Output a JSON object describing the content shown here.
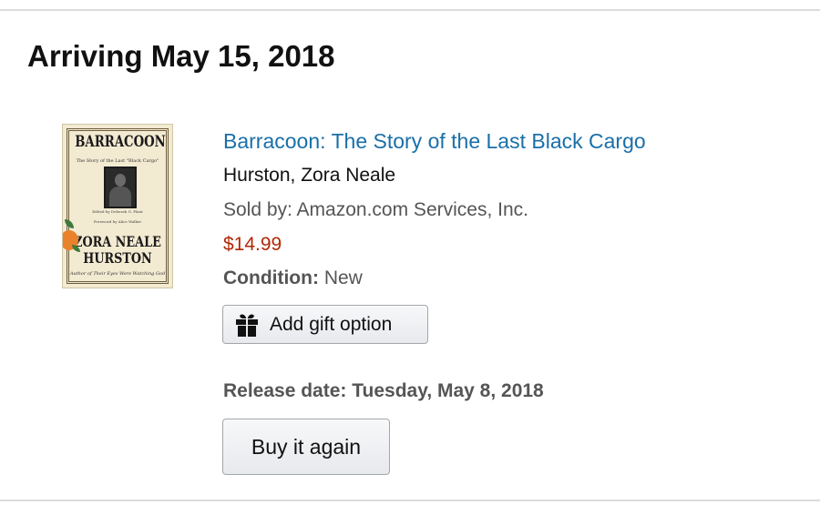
{
  "shipment": {
    "heading": "Arriving May 15, 2018"
  },
  "item": {
    "cover": {
      "title_text": "BARRACOON",
      "subtitle_text": "The Story of the Last \"Black Cargo\"",
      "editor_text": "Edited by Deborah G. Plant",
      "foreword_text": "Foreword by Alice Walker",
      "author_line1": "ZORA NEALE",
      "author_line2": "HURSTON",
      "footer_text": "Author of Their Eyes Were Watching God"
    },
    "title": "Barracoon: The Story of the Last Black Cargo",
    "author": "Hurston, Zora Neale",
    "sold_by": "Sold by: Amazon.com Services, Inc.",
    "price": "$14.99",
    "condition_label": "Condition:",
    "condition_value": "New",
    "release_date": "Release date: Tuesday, May 8, 2018"
  },
  "actions": {
    "gift_label": "Add gift option",
    "gift_icon": "gift-icon",
    "buy_again_label": "Buy it again"
  },
  "colors": {
    "link": "#1a6fa8",
    "price": "#b12704",
    "secondary_text": "#555555",
    "primary_text": "#111111"
  }
}
